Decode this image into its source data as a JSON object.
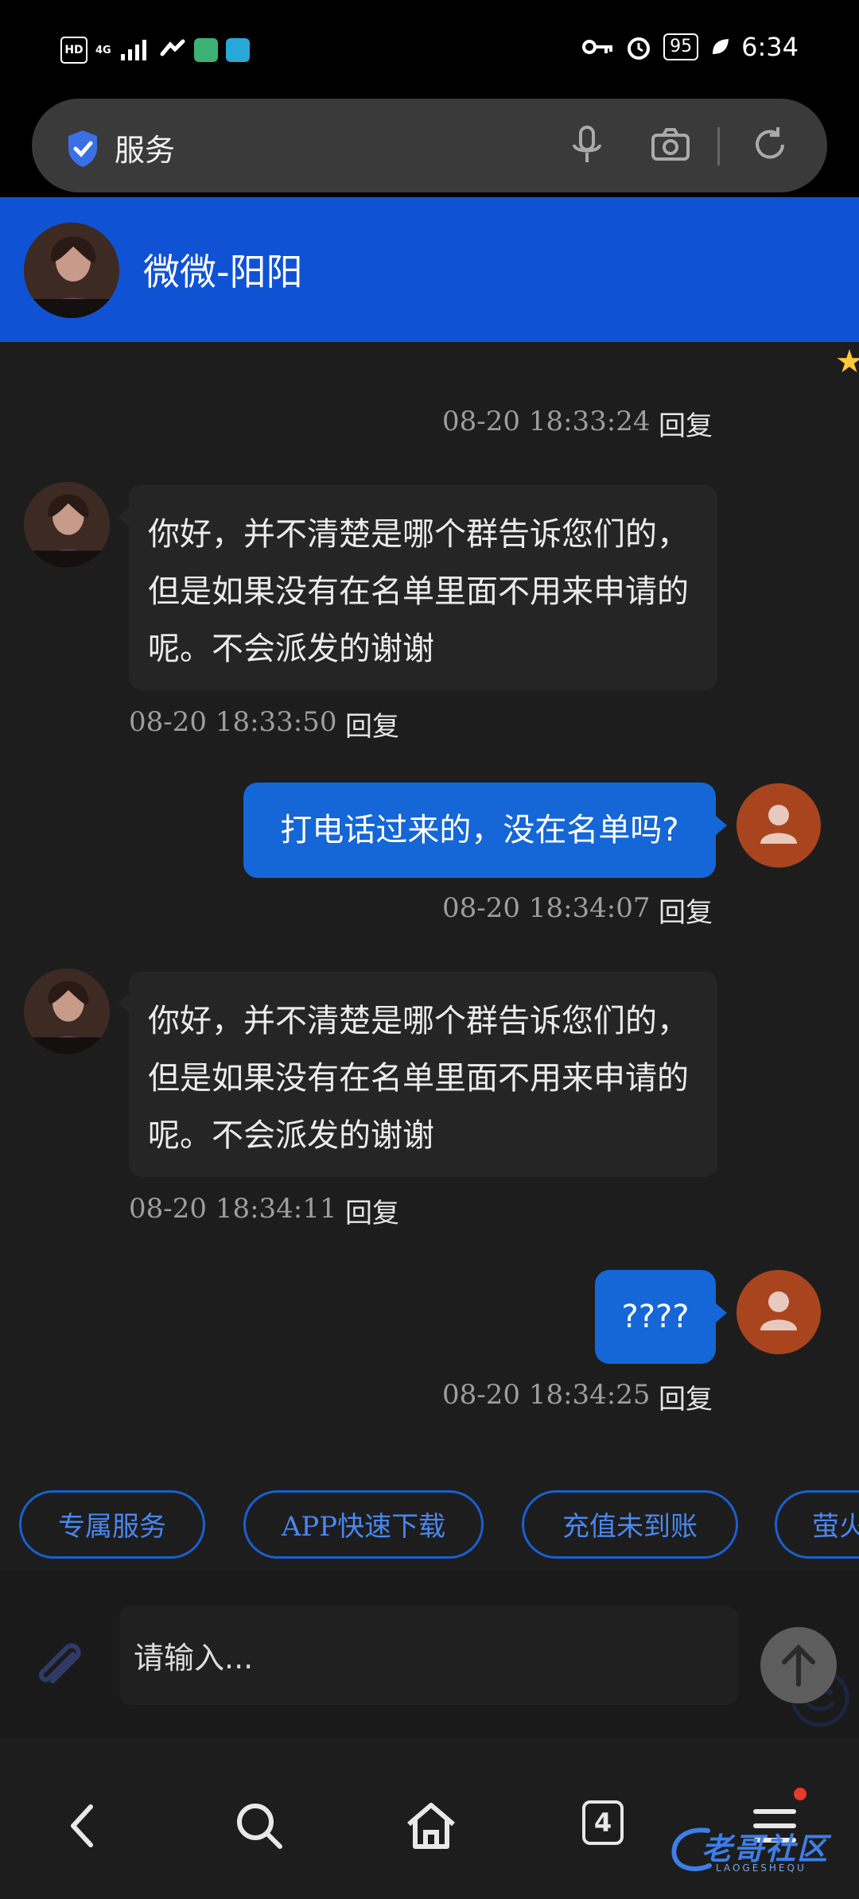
{
  "status_bar": {
    "hd_label": "HD",
    "network_label": "4G",
    "battery": "95",
    "time": "6:34"
  },
  "browser": {
    "url_text": "服务"
  },
  "chat_header": {
    "contact_name": "微微-阳阳"
  },
  "messages": [
    {
      "type": "meta",
      "timestamp": "08-20 18:33:24",
      "reply_label": "回复"
    },
    {
      "type": "incoming",
      "text": "你好，并不清楚是哪个群告诉您们的，但是如果没有在名单里面不用来申请的呢。不会派发的谢谢",
      "timestamp": "08-20 18:33:50",
      "reply_label": "回复"
    },
    {
      "type": "outgoing",
      "text": "打电话过来的，没在名单吗?",
      "timestamp": "08-20 18:34:07",
      "reply_label": "回复"
    },
    {
      "type": "incoming",
      "text": "你好，并不清楚是哪个群告诉您们的，但是如果没有在名单里面不用来申请的呢。不会派发的谢谢",
      "timestamp": "08-20 18:34:11",
      "reply_label": "回复"
    },
    {
      "type": "outgoing",
      "text": "????",
      "timestamp": "08-20 18:34:25",
      "reply_label": "回复"
    }
  ],
  "quick_replies": [
    "专属服务",
    "APP快速下载",
    "充值未到账",
    "萤火"
  ],
  "input": {
    "placeholder": "请输入..."
  },
  "nav": {
    "tab_count": "4"
  },
  "watermark": {
    "text": "老哥社区",
    "sub": "LAOGESHEQU"
  },
  "colors": {
    "header_blue": "#1052d4",
    "outgoing_bubble": "#1566d6",
    "incoming_bubble": "#252525",
    "background": "#1d1d1d",
    "chip_border": "#1a5fd2",
    "user_avatar": "#a9451e"
  }
}
